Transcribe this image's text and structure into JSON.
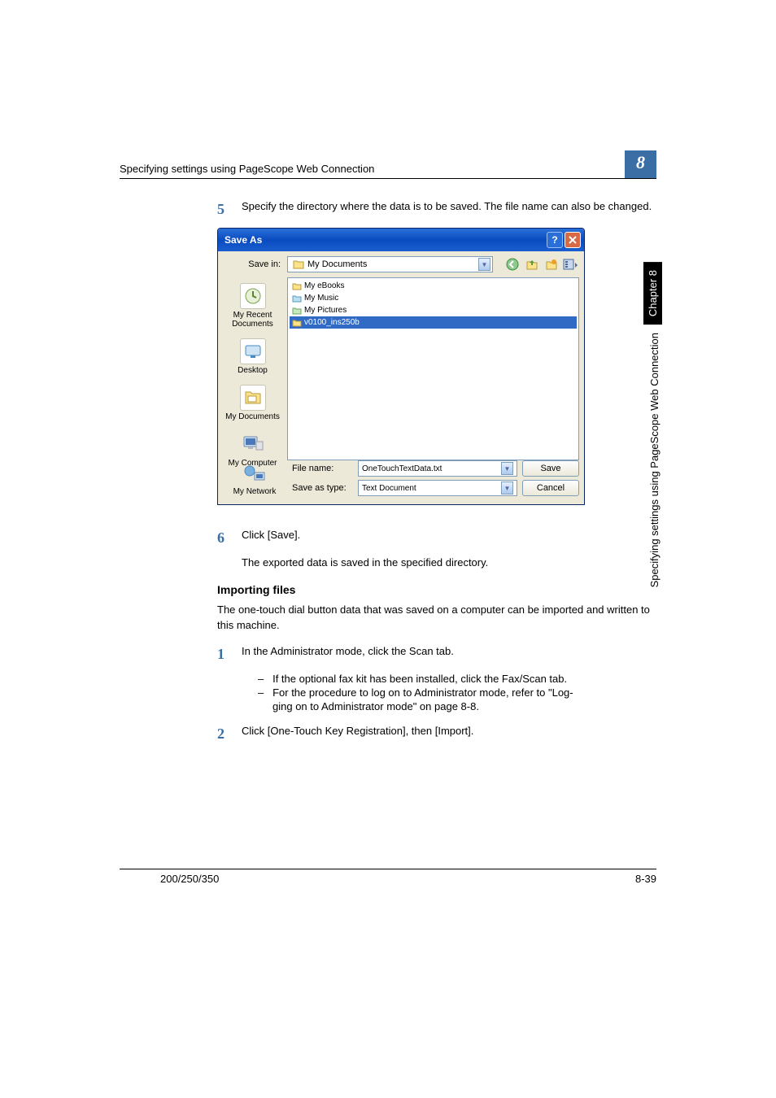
{
  "header": {
    "title": "Specifying settings using PageScope Web Connection",
    "chapter_number": "8"
  },
  "step5": {
    "num": "5",
    "text": "Specify the directory where the data is to be saved. The file name can also be changed."
  },
  "dialog": {
    "title": "Save As",
    "save_in_label": "Save in:",
    "save_in_value": "My Documents",
    "places": {
      "recent": "My Recent Documents",
      "desktop": "Desktop",
      "mydocs": "My Documents",
      "mycomp": "My Computer",
      "mynet": "My Network"
    },
    "files": {
      "ebooks": "My eBooks",
      "music": "My Music",
      "pictures": "My Pictures",
      "v0100": "v0100_ins250b"
    },
    "filename_label": "File name:",
    "filename_value": "OneTouchTextData.txt",
    "type_label": "Save as type:",
    "type_value": "Text Document",
    "save_btn": "Save",
    "cancel_btn": "Cancel"
  },
  "step6": {
    "num": "6",
    "text": "Click [Save].",
    "sub": "The exported data is saved in the specified directory."
  },
  "importing": {
    "title": "Importing files",
    "para": "The one-touch dial button data that was saved on a computer can be imported and written to this machine."
  },
  "step1": {
    "num": "1",
    "text": "In the Administrator mode, click the Scan tab.",
    "b1": "If the optional fax kit has been installed, click the Fax/Scan tab.",
    "b2_a": "For the procedure to log on to Administrator mode, refer to \"Log",
    "b2_b": "ging on to Administrator mode\" on page 8-8."
  },
  "step2": {
    "num": "2",
    "text": "Click [One-Touch Key Registration], then [Import]."
  },
  "side": {
    "chapter": "Chapter 8",
    "vtext": "Specifying settings using PageScope Web Connection"
  },
  "footer": {
    "left": "200/250/350",
    "right": "8-39"
  }
}
